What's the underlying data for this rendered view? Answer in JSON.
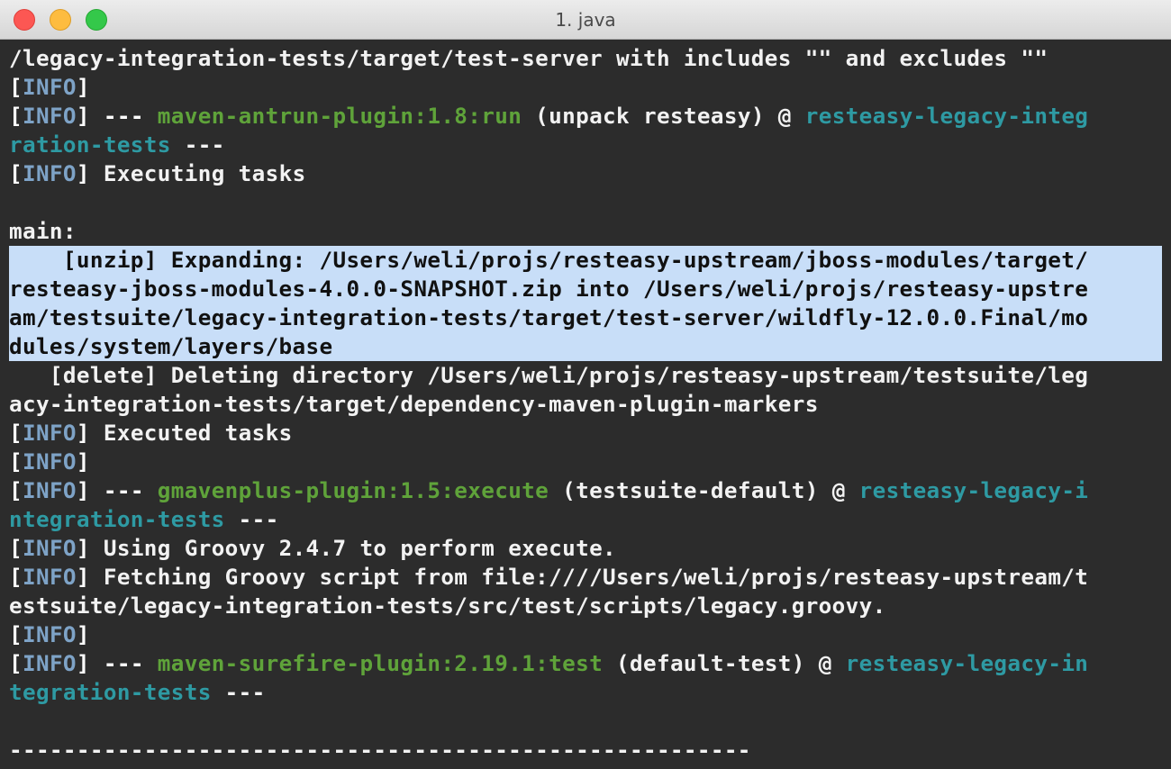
{
  "window": {
    "title": "1. java",
    "buttons": {
      "close": "close",
      "minimize": "minimize",
      "maximize": "maximize"
    }
  },
  "colors": {
    "info": "#7ea3c7",
    "plugin": "#5fa33a",
    "project": "#2e9aa3",
    "text": "#f2f2f2",
    "selection": "#c8def8",
    "background": "#2c2c2c"
  },
  "terminal": {
    "lines": [
      {
        "segments": [
          {
            "c": "text",
            "t": "/legacy-integration-tests/target/test-server with includes \"\" and excludes \"\""
          }
        ]
      },
      {
        "segments": [
          {
            "c": "tag",
            "t": "["
          },
          {
            "c": "info",
            "t": "INFO"
          },
          {
            "c": "tag",
            "t": "]"
          }
        ]
      },
      {
        "segments": [
          {
            "c": "tag",
            "t": "["
          },
          {
            "c": "info",
            "t": "INFO"
          },
          {
            "c": "tag",
            "t": "] --- "
          },
          {
            "c": "plugin",
            "t": "maven-antrun-plugin:1.8:run"
          },
          {
            "c": "text",
            "t": " (unpack resteasy) @ "
          },
          {
            "c": "proj",
            "t": "resteasy-legacy-integ"
          }
        ]
      },
      {
        "segments": [
          {
            "c": "proj",
            "t": "ration-tests"
          },
          {
            "c": "text",
            "t": " ---"
          }
        ]
      },
      {
        "segments": [
          {
            "c": "tag",
            "t": "["
          },
          {
            "c": "info",
            "t": "INFO"
          },
          {
            "c": "tag",
            "t": "] "
          },
          {
            "c": "text",
            "t": "Executing tasks"
          }
        ]
      },
      {
        "segments": [
          {
            "c": "text",
            "t": ""
          }
        ]
      },
      {
        "segments": [
          {
            "c": "text",
            "t": "main:"
          }
        ]
      },
      {
        "selected": true,
        "segments": [
          {
            "c": "text",
            "t": "    [unzip] Expanding: /Users/weli/projs/resteasy-upstream/jboss-modules/target/"
          }
        ]
      },
      {
        "selected": true,
        "segments": [
          {
            "c": "text",
            "t": "resteasy-jboss-modules-4.0.0-SNAPSHOT.zip into /Users/weli/projs/resteasy-upstre"
          }
        ]
      },
      {
        "selected": true,
        "segments": [
          {
            "c": "text",
            "t": "am/testsuite/legacy-integration-tests/target/test-server/wildfly-12.0.0.Final/mo"
          }
        ]
      },
      {
        "selected": true,
        "segments": [
          {
            "c": "text",
            "t": "dules/system/layers/base"
          }
        ]
      },
      {
        "segments": [
          {
            "c": "text",
            "t": "   [delete] Deleting directory /Users/weli/projs/resteasy-upstream/testsuite/leg"
          }
        ]
      },
      {
        "segments": [
          {
            "c": "text",
            "t": "acy-integration-tests/target/dependency-maven-plugin-markers"
          }
        ]
      },
      {
        "segments": [
          {
            "c": "tag",
            "t": "["
          },
          {
            "c": "info",
            "t": "INFO"
          },
          {
            "c": "tag",
            "t": "] "
          },
          {
            "c": "text",
            "t": "Executed tasks"
          }
        ]
      },
      {
        "segments": [
          {
            "c": "tag",
            "t": "["
          },
          {
            "c": "info",
            "t": "INFO"
          },
          {
            "c": "tag",
            "t": "]"
          }
        ]
      },
      {
        "segments": [
          {
            "c": "tag",
            "t": "["
          },
          {
            "c": "info",
            "t": "INFO"
          },
          {
            "c": "tag",
            "t": "] --- "
          },
          {
            "c": "plugin",
            "t": "gmavenplus-plugin:1.5:execute"
          },
          {
            "c": "text",
            "t": " (testsuite-default) @ "
          },
          {
            "c": "proj",
            "t": "resteasy-legacy-i"
          }
        ]
      },
      {
        "segments": [
          {
            "c": "proj",
            "t": "ntegration-tests"
          },
          {
            "c": "text",
            "t": " ---"
          }
        ]
      },
      {
        "segments": [
          {
            "c": "tag",
            "t": "["
          },
          {
            "c": "info",
            "t": "INFO"
          },
          {
            "c": "tag",
            "t": "] "
          },
          {
            "c": "text",
            "t": "Using Groovy 2.4.7 to perform execute."
          }
        ]
      },
      {
        "segments": [
          {
            "c": "tag",
            "t": "["
          },
          {
            "c": "info",
            "t": "INFO"
          },
          {
            "c": "tag",
            "t": "] "
          },
          {
            "c": "text",
            "t": "Fetching Groovy script from file:////Users/weli/projs/resteasy-upstream/t"
          }
        ]
      },
      {
        "segments": [
          {
            "c": "text",
            "t": "estsuite/legacy-integration-tests/src/test/scripts/legacy.groovy."
          }
        ]
      },
      {
        "segments": [
          {
            "c": "tag",
            "t": "["
          },
          {
            "c": "info",
            "t": "INFO"
          },
          {
            "c": "tag",
            "t": "]"
          }
        ]
      },
      {
        "segments": [
          {
            "c": "tag",
            "t": "["
          },
          {
            "c": "info",
            "t": "INFO"
          },
          {
            "c": "tag",
            "t": "] --- "
          },
          {
            "c": "plugin",
            "t": "maven-surefire-plugin:2.19.1:test"
          },
          {
            "c": "text",
            "t": " (default-test) @ "
          },
          {
            "c": "proj",
            "t": "resteasy-legacy-in"
          }
        ]
      },
      {
        "segments": [
          {
            "c": "proj",
            "t": "tegration-tests"
          },
          {
            "c": "text",
            "t": " ---"
          }
        ]
      },
      {
        "segments": [
          {
            "c": "text",
            "t": ""
          }
        ]
      },
      {
        "segments": [
          {
            "c": "text",
            "t": "-------------------------------------------------------"
          }
        ]
      }
    ]
  }
}
